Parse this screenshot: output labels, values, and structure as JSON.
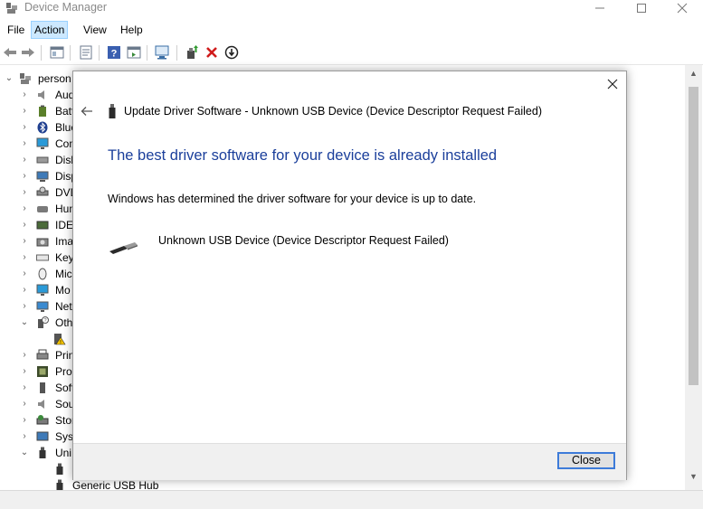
{
  "window": {
    "title": "Device Manager",
    "controls": {
      "minimize": "minimize-icon",
      "maximize": "maximize-icon",
      "close": "close-icon"
    }
  },
  "menu": {
    "file": "File",
    "action": "Action",
    "view": "View",
    "help": "Help"
  },
  "toolbar": {
    "icons": [
      "back-arrow-icon",
      "forward-arrow-icon",
      "properties-icon",
      "console-tree-icon",
      "help-icon",
      "action-pane-icon",
      "scan-hardware-icon",
      "update-driver-icon",
      "uninstall-icon",
      "disable-icon"
    ]
  },
  "tree": {
    "root": "person",
    "items": [
      {
        "label": "Audi",
        "icon": "speaker-icon"
      },
      {
        "label": "Batt",
        "icon": "battery-icon"
      },
      {
        "label": "Blue",
        "icon": "bluetooth-icon"
      },
      {
        "label": "Com",
        "icon": "monitor-icon"
      },
      {
        "label": "Disk",
        "icon": "disk-icon"
      },
      {
        "label": "Disp",
        "icon": "display-icon"
      },
      {
        "label": "DVD",
        "icon": "dvd-icon"
      },
      {
        "label": "Hum",
        "icon": "hid-icon"
      },
      {
        "label": "IDE",
        "icon": "ide-icon"
      },
      {
        "label": "Ima",
        "icon": "camera-icon"
      },
      {
        "label": "Key",
        "icon": "keyboard-icon"
      },
      {
        "label": "Mic",
        "icon": "mouse-icon"
      },
      {
        "label": "Mo",
        "icon": "monitor-icon"
      },
      {
        "label": "Net",
        "icon": "network-icon"
      },
      {
        "label": "Oth",
        "icon": "other-devices-icon"
      },
      {
        "label": "",
        "icon": "warning-device-icon"
      },
      {
        "label": "Prin",
        "icon": "printer-icon"
      },
      {
        "label": "Pro",
        "icon": "processor-icon"
      },
      {
        "label": "Soft",
        "icon": "software-icon"
      },
      {
        "label": "Sou",
        "icon": "speaker-icon"
      },
      {
        "label": "Stor",
        "icon": "storage-icon"
      },
      {
        "label": "Syst",
        "icon": "system-icon"
      },
      {
        "label": "Uni",
        "icon": "usb-icon"
      },
      {
        "label": "",
        "icon": "usb-device-icon"
      },
      {
        "label": "Generic USB Hub",
        "icon": "usb-device-icon"
      }
    ]
  },
  "dialog": {
    "title": "Update Driver Software - Unknown USB Device (Device Descriptor Request Failed)",
    "heading": "The best driver software for your device is already installed",
    "message": "Windows has determined the driver software for your device is up to date.",
    "device_name": "Unknown USB Device (Device Descriptor Request Failed)",
    "close_button": "Close",
    "heading_color": "#1b3f9b",
    "button_border_color": "#3d7bd9"
  }
}
